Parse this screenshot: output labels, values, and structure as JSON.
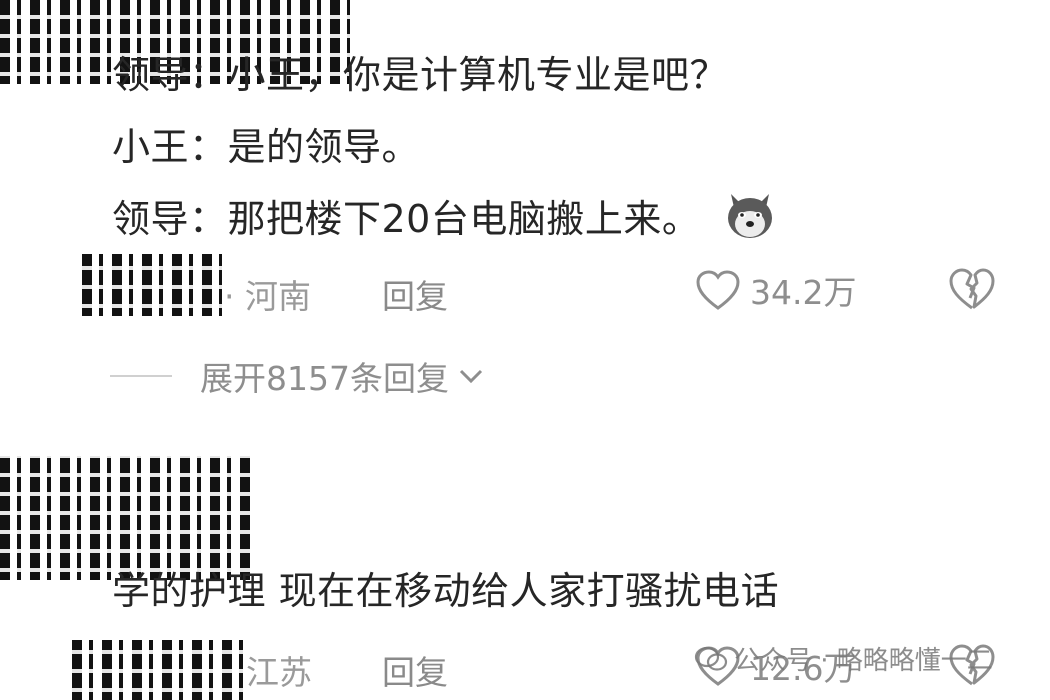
{
  "comments": [
    {
      "lines": [
        "领导：小王，你是计算机专业是吧？",
        "小王：是的领导。",
        "领导：那把楼下20台电脑搬上来。"
      ],
      "emoji": "wolf-face-emoji",
      "location": "· 河南",
      "reply_label": "回复",
      "likes": "34.2万",
      "expand_label": "展开8157条回复"
    },
    {
      "text": "学的护理 现在在移动给人家打骚扰电话",
      "location": "江苏",
      "reply_label": "回复",
      "likes": "12.6万"
    }
  ],
  "watermark": {
    "text": "公众号 · 略略略懂一二"
  },
  "icons": {
    "like": "heart-outline-icon",
    "dislike": "broken-heart-icon",
    "expand": "chevron-down-icon"
  },
  "colors": {
    "text": "#262626",
    "muted": "#9a9a9a",
    "background": "#ffffff"
  }
}
